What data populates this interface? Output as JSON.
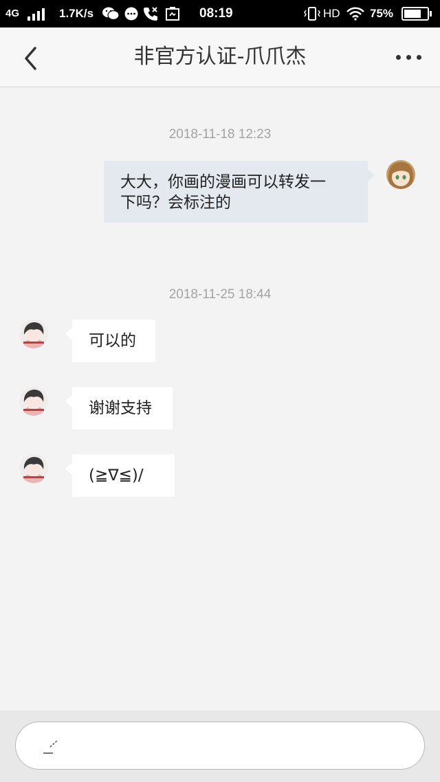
{
  "status_bar": {
    "network": "4G",
    "speed": "1.7K/s",
    "time": "08:19",
    "hd": "HD",
    "battery": "75%",
    "battery_level": 0.75
  },
  "header": {
    "title": "非官方认证-爪爪杰"
  },
  "messages": [
    {
      "timestamp": "2018-11-18 12:23"
    },
    {
      "text_line1": "大大，你画的漫画可以转发一",
      "text_line2": "下吗？会标注的"
    },
    {
      "timestamp": "2018-11-25 18:44"
    },
    {
      "text": "可以的"
    },
    {
      "text": "谢谢支持"
    },
    {
      "text": "(≧∇≦)/"
    }
  ],
  "colors": {
    "accent_bubble_mine": "#e3e9ef",
    "bubble_theirs": "#ffffff",
    "background": "#f3f3f3"
  }
}
